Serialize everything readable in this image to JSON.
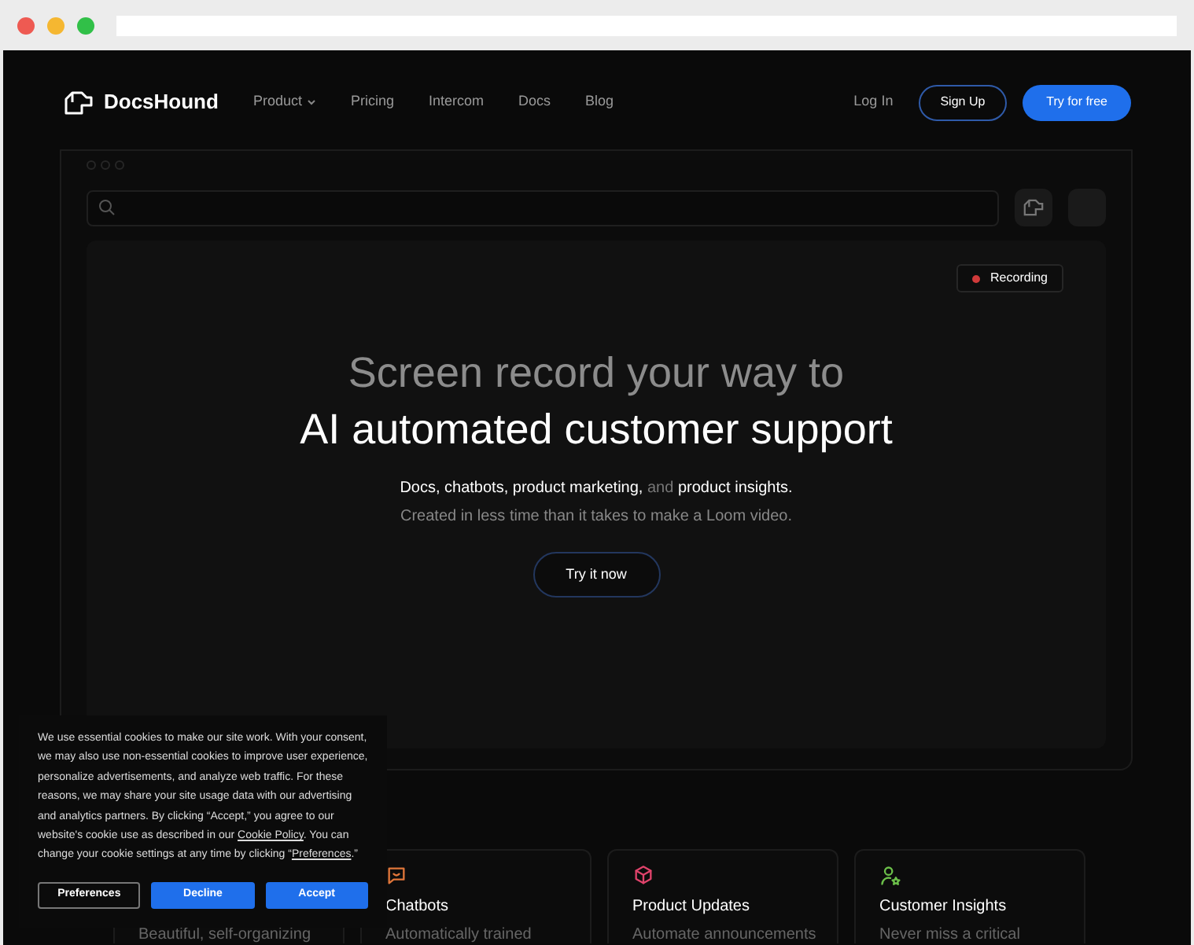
{
  "nav": {
    "brand": "DocsHound",
    "items": [
      {
        "label": "Product",
        "dropdown": true
      },
      {
        "label": "Pricing",
        "dropdown": false
      },
      {
        "label": "Intercom",
        "dropdown": false
      },
      {
        "label": "Docs",
        "dropdown": false
      },
      {
        "label": "Blog",
        "dropdown": false
      }
    ],
    "login": "Log In",
    "signup": "Sign Up",
    "cta": "Try for free"
  },
  "hero": {
    "badge": "Recording",
    "title_line_1": "Screen record your way to",
    "title_line_2": "AI automated customer support",
    "subtitle": [
      {
        "text": "Docs, chatbots, product marketing,",
        "muted": false
      },
      {
        "text": "and",
        "muted": true
      },
      {
        "text": "product insights.",
        "muted": false
      }
    ],
    "note": "Created in less time than it takes to make a Loom video.",
    "button": "Try it now"
  },
  "features": [
    {
      "description": "Beautiful, self-organizing"
    },
    {
      "kind": "chat",
      "color": "#e0763a",
      "title": "Chatbots",
      "description": "Automatically trained"
    },
    {
      "kind": "cube",
      "color": "#e0436b",
      "title": "Product Updates",
      "description": "Automate announcements"
    },
    {
      "kind": "person",
      "color": "#6cc04a",
      "title": "Customer Insights",
      "description": "Never miss a critical"
    }
  ],
  "cookie_banner": {
    "text": [
      {
        "kind": "text",
        "text": "We use essential cookies to make our site work. With your consent, we may also use non-essential cookies to improve user experience, personalize advertisements, and analyze web traffic. For these reasons, we may share your site usage data with our advertising and analytics partners. By clicking “Accept,” you agree to our website's cookie use as described in our "
      },
      {
        "kind": "link",
        "text": "Cookie Policy"
      },
      {
        "kind": "text",
        "text": ". You can change your cookie settings at any time by clicking “"
      },
      {
        "kind": "link",
        "text": "Preferences"
      },
      {
        "kind": "text",
        "text": ".”"
      }
    ],
    "buttons": [
      {
        "label": "Preferences",
        "kind": "outline"
      },
      {
        "label": "Decline",
        "kind": "filled"
      },
      {
        "label": "Accept",
        "kind": "filled"
      }
    ]
  }
}
